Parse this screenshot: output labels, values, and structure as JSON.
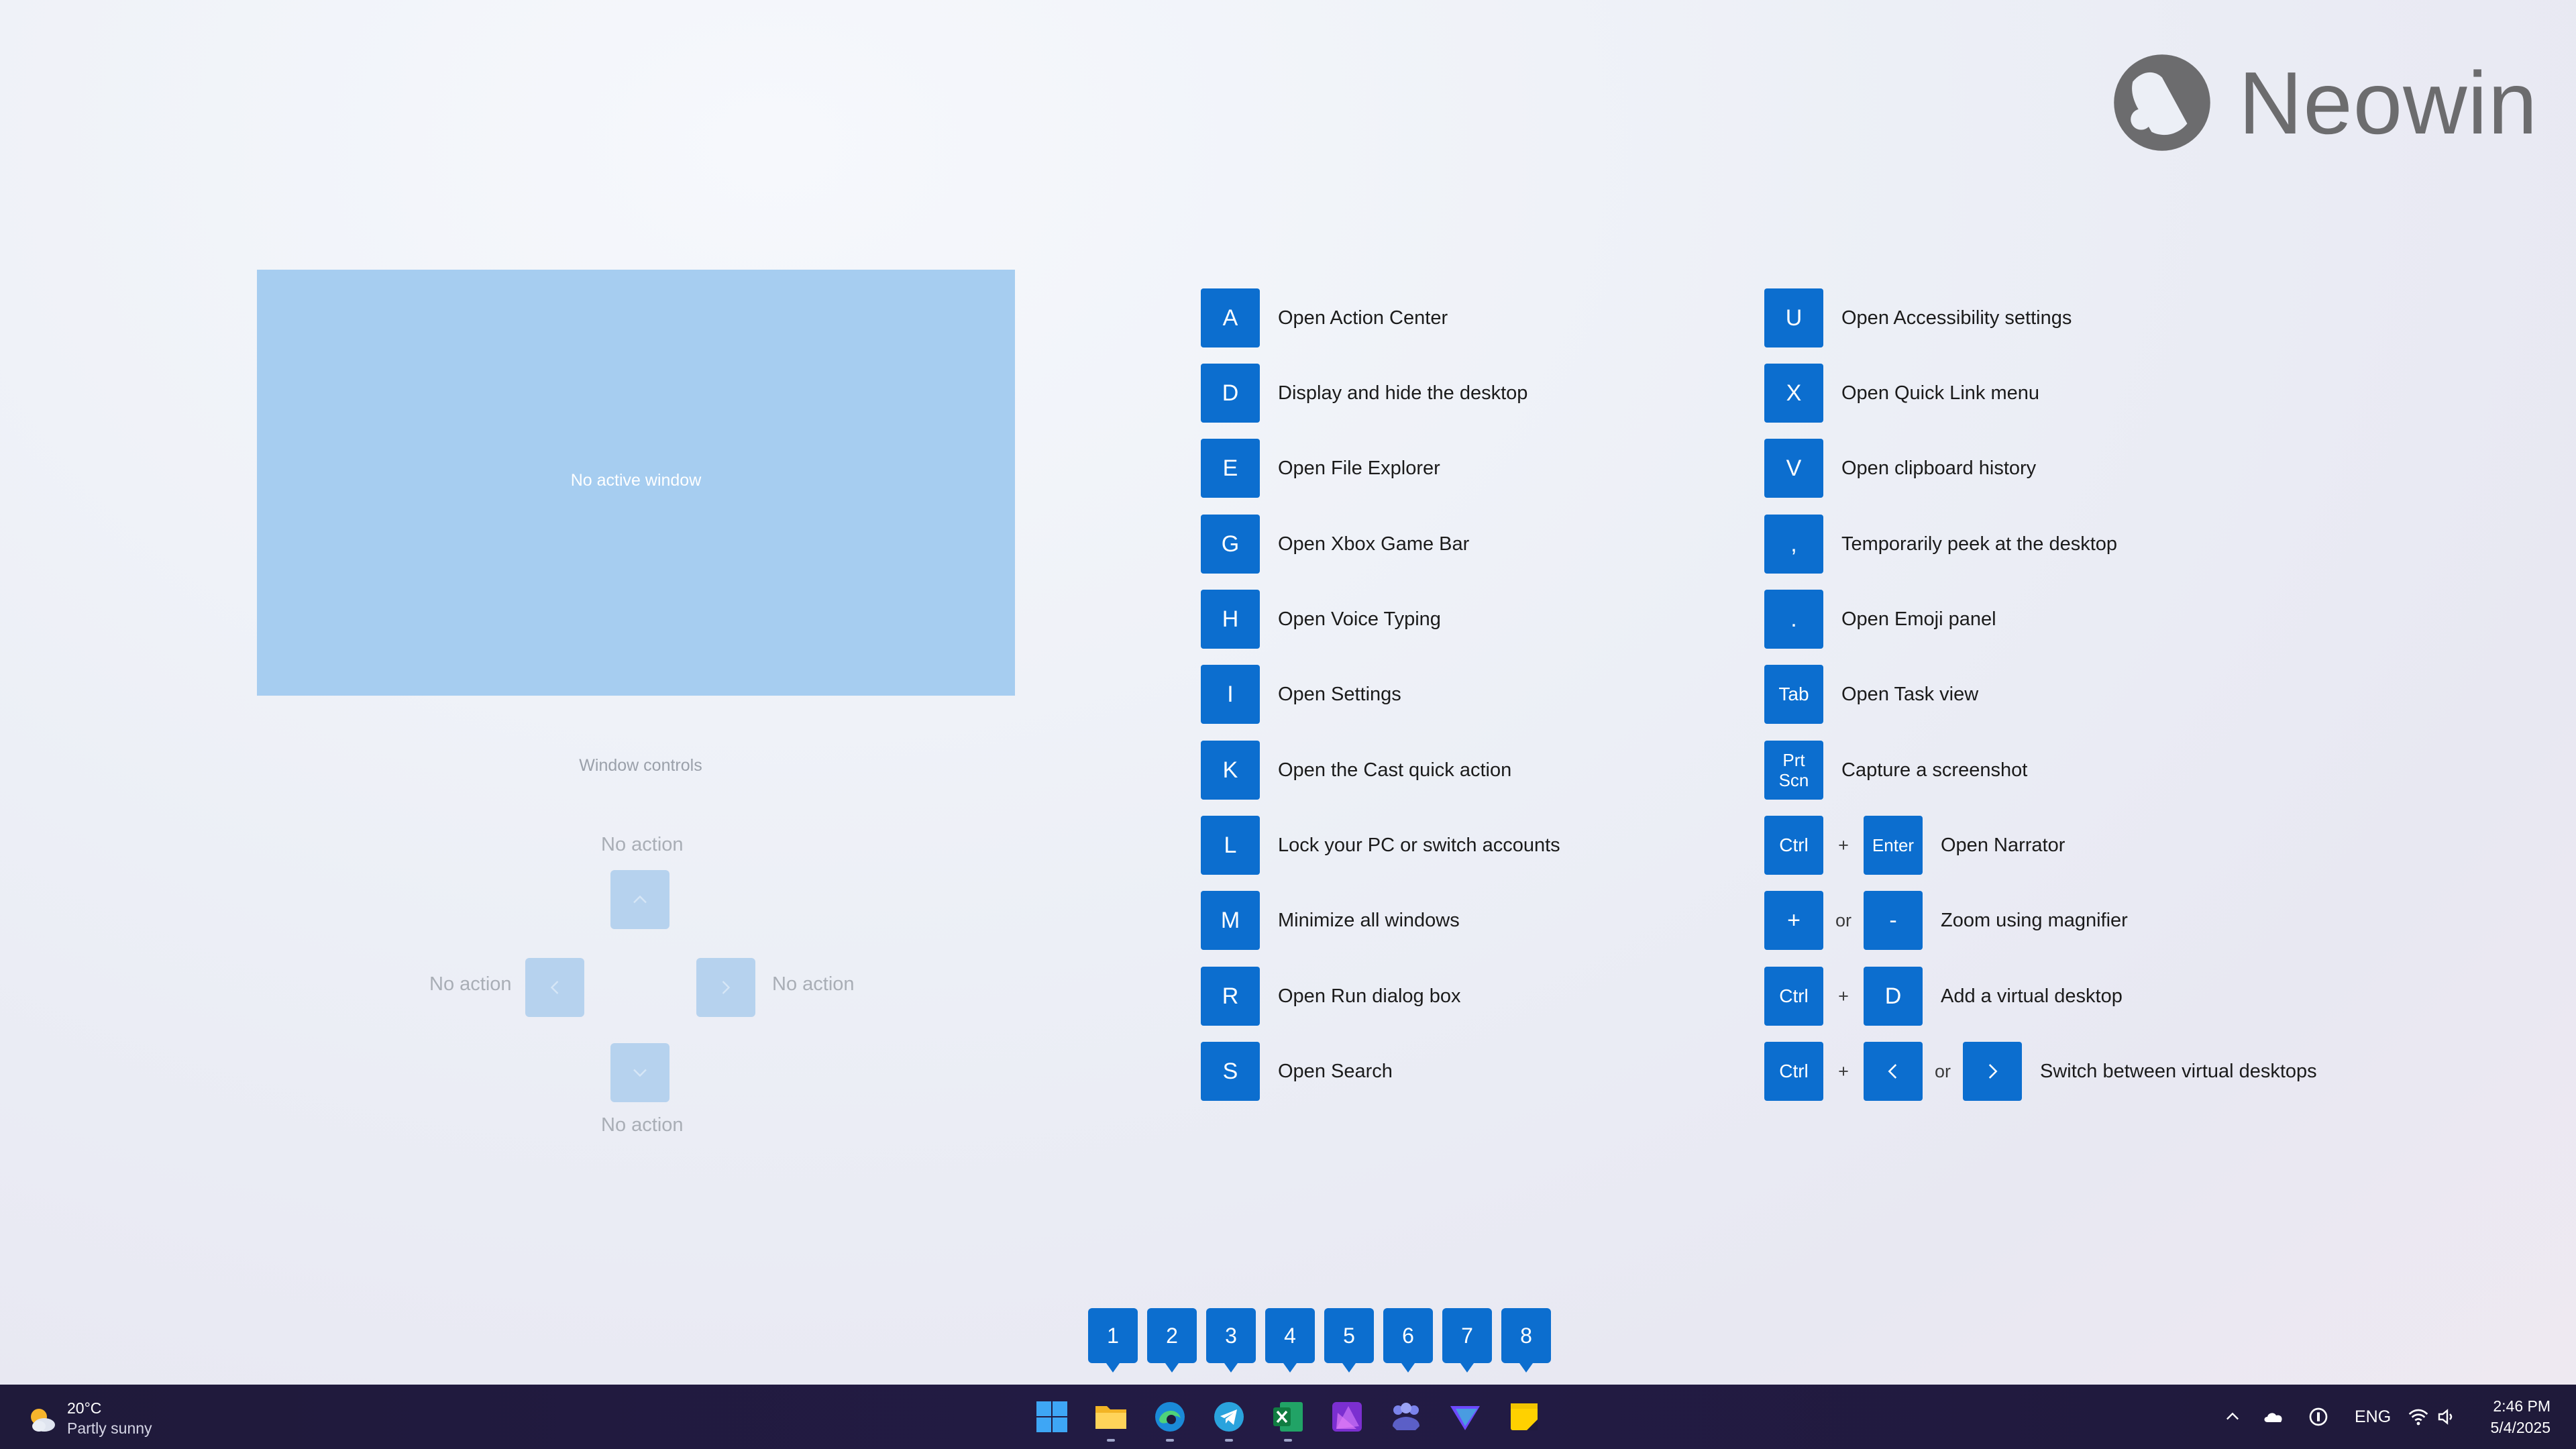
{
  "watermark": {
    "brand": "Neowin"
  },
  "preview": {
    "label": "No active window"
  },
  "window_controls": {
    "title": "Window controls",
    "up": "No action",
    "left": "No action",
    "right": "No action",
    "down": "No action",
    "icons": {
      "up": "chevron-up-icon",
      "left": "chevron-left-icon",
      "right": "chevron-right-icon",
      "down": "chevron-down-icon"
    }
  },
  "shortcuts_left": [
    {
      "key": "A",
      "desc": "Open Action Center"
    },
    {
      "key": "D",
      "desc": "Display and hide the desktop"
    },
    {
      "key": "E",
      "desc": "Open File Explorer"
    },
    {
      "key": "G",
      "desc": "Open Xbox Game Bar"
    },
    {
      "key": "H",
      "desc": "Open Voice Typing"
    },
    {
      "key": "I",
      "desc": "Open Settings"
    },
    {
      "key": "K",
      "desc": "Open the Cast quick action"
    },
    {
      "key": "L",
      "desc": "Lock your PC or switch accounts"
    },
    {
      "key": "M",
      "desc": "Minimize all windows"
    },
    {
      "key": "R",
      "desc": "Open Run dialog box"
    },
    {
      "key": "S",
      "desc": "Open Search"
    }
  ],
  "shortcuts_right": [
    {
      "key": "U",
      "desc": "Open Accessibility settings"
    },
    {
      "key": "X",
      "desc": "Open Quick Link menu"
    },
    {
      "key": "V",
      "desc": "Open clipboard history"
    },
    {
      "key": ",",
      "desc": "Temporarily peek at the desktop"
    },
    {
      "key": ".",
      "desc": "Open Emoji panel"
    },
    {
      "key": "Tab",
      "desc": "Open Task view"
    },
    {
      "key": "Prt Scn",
      "desc": "Capture a screenshot"
    }
  ],
  "combos": {
    "narrator": {
      "k1": "Ctrl",
      "plus": "+",
      "k2": "Enter",
      "desc": "Open Narrator"
    },
    "magnifier": {
      "k1": "+",
      "or": "or",
      "k2": "-",
      "desc": "Zoom using magnifier"
    },
    "virtual_desktop": {
      "k1": "Ctrl",
      "plus": "+",
      "k2": "D",
      "desc": "Add a virtual desktop"
    },
    "switch_desktop": {
      "k1": "Ctrl",
      "plus": "+",
      "or": "or",
      "desc": "Switch between virtual desktops",
      "icons": [
        "chevron-left-icon",
        "chevron-right-icon"
      ]
    }
  },
  "taskbar_badges": [
    "1",
    "2",
    "3",
    "4",
    "5",
    "6",
    "7",
    "8"
  ],
  "taskbar": {
    "weather": {
      "temp": "20°C",
      "condition": "Partly sunny",
      "icon": "partly-sunny-icon"
    },
    "apps": [
      "start-icon",
      "file-explorer-icon",
      "edge-icon",
      "telegram-icon",
      "excel-icon",
      "affinity-photo-icon",
      "teams-icon",
      "proton-vpn-icon",
      "sticky-notes-icon"
    ],
    "tray": {
      "language": "ENG",
      "icons": [
        "chevron-up-icon",
        "onedrive-icon",
        "vpn-icon",
        "wifi-icon",
        "volume-icon"
      ]
    },
    "clock": {
      "time": "2:46 PM",
      "date": "5/4/2025"
    }
  },
  "colors": {
    "accent": "#0c6ecf",
    "preview": "#a6cdf0",
    "taskbar": "#211b41"
  }
}
